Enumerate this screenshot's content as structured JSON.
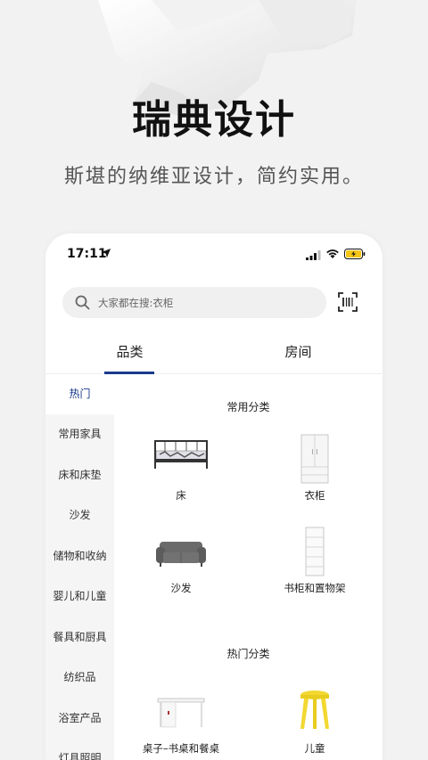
{
  "hero": {
    "title": "瑞典设计",
    "subtitle": "斯堪的纳维亚设计，简约实用。"
  },
  "status_bar": {
    "time": "17:11"
  },
  "search": {
    "placeholder": "大家都在搜:衣柜"
  },
  "tabs": [
    {
      "label": "品类",
      "active": true
    },
    {
      "label": "房间",
      "active": false
    }
  ],
  "sidebar": {
    "items": [
      {
        "label": "热门",
        "active": true
      },
      {
        "label": "常用家具"
      },
      {
        "label": "床和床垫"
      },
      {
        "label": "沙发"
      },
      {
        "label": "储物和收纳"
      },
      {
        "label": "婴儿和儿童"
      },
      {
        "label": "餐具和厨具"
      },
      {
        "label": "纺织品"
      },
      {
        "label": "浴室产品"
      },
      {
        "label": "灯具照明"
      }
    ]
  },
  "sections": [
    {
      "title": "常用分类",
      "items": [
        {
          "label": "床",
          "icon": "bed-image"
        },
        {
          "label": "衣柜",
          "icon": "wardrobe-image"
        },
        {
          "label": "沙发",
          "icon": "sofa-image"
        },
        {
          "label": "书柜和置物架",
          "icon": "bookcase-image"
        }
      ]
    },
    {
      "title": "热门分类",
      "items": [
        {
          "label": "桌子–书桌和餐桌",
          "icon": "desk-image"
        },
        {
          "label": "儿童",
          "icon": "kids-stool-image"
        }
      ]
    }
  ],
  "colors": {
    "accent": "#1a3a8c",
    "background": "#f2f2f2",
    "battery": "#f5c518"
  }
}
